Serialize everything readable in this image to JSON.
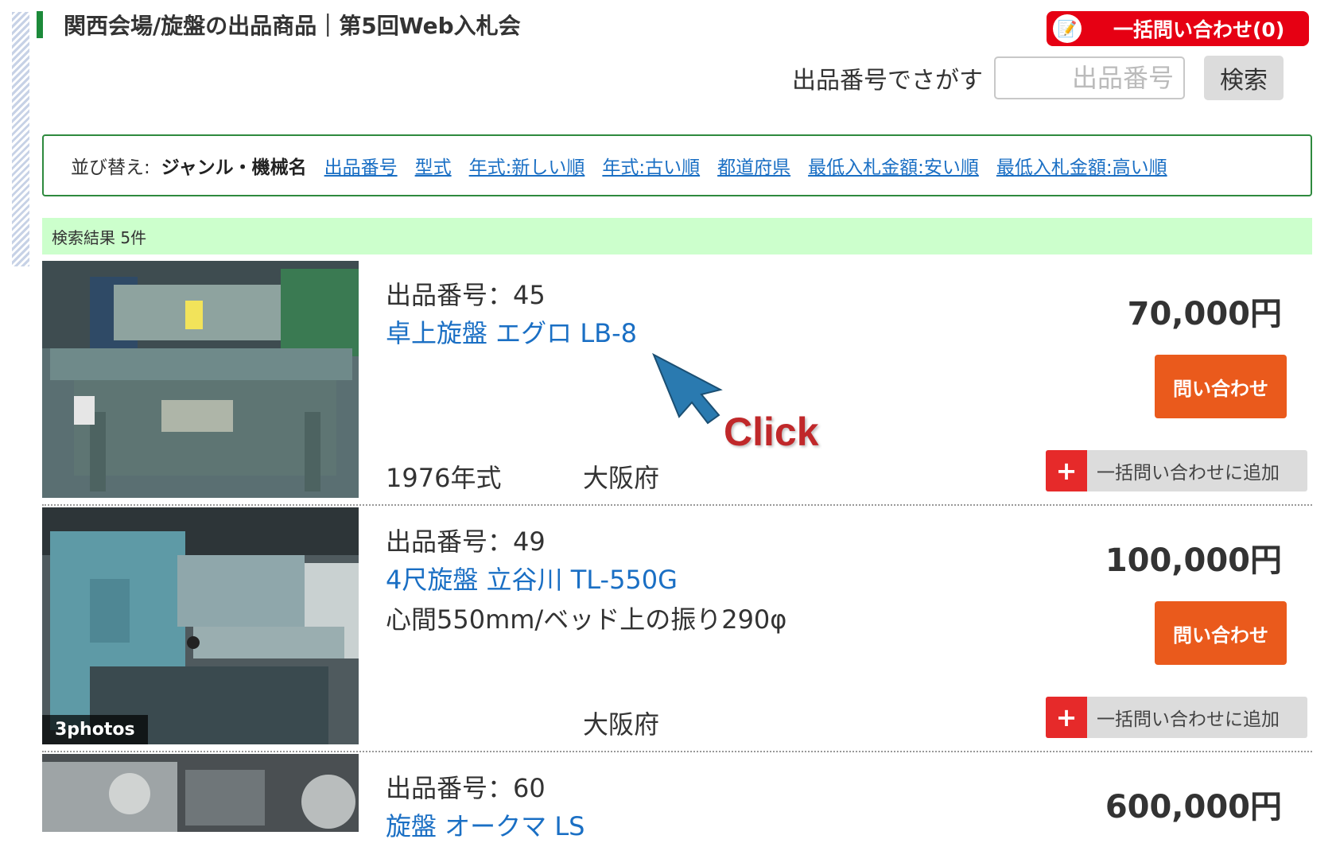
{
  "header": {
    "title": "関西会場/旋盤の出品商品｜第5回Web入札会",
    "bulk_inquiry_label": "一括問い合わせ(0)",
    "bulk_icon": "clipboard-icon"
  },
  "search": {
    "label": "出品番号でさがす",
    "placeholder": "出品番号",
    "value": "",
    "button_label": "検索"
  },
  "sort": {
    "label": "並び替え:",
    "current": "ジャンル・機械名",
    "options": [
      "出品番号",
      "型式",
      "年式:新しい順",
      "年式:古い順",
      "都道府県",
      "最低入札金額:安い順",
      "最低入札金額:高い順"
    ]
  },
  "results": {
    "summary": "検索結果 5件"
  },
  "items": [
    {
      "number": "出品番号：45",
      "name": "卓上旋盤 エグロ LB-8",
      "spec": "",
      "year": "1976年式",
      "prefecture": "大阪府",
      "price": "70,000円",
      "inquire_label": "問い合わせ",
      "add_label": "一括問い合わせに追加",
      "photos": ""
    },
    {
      "number": "出品番号：49",
      "name": "4尺旋盤 立谷川 TL-550G",
      "spec": "心間550mm/ベッド上の振り290φ",
      "year": "",
      "prefecture": "大阪府",
      "price": "100,000円",
      "inquire_label": "問い合わせ",
      "add_label": "一括問い合わせに追加",
      "photos": "3photos"
    },
    {
      "number": "出品番号：60",
      "name": "旋盤 オークマ LS",
      "price": "600,000円"
    }
  ],
  "overlay": {
    "click_label": "Click",
    "cursor_color": "#2a7ab0"
  },
  "colors": {
    "accent_green": "#1c8a3a",
    "link_blue": "#1a6fc4",
    "inquire_orange": "#ea5a1c",
    "bulk_red": "#e60013",
    "result_bar": "#ccffcc"
  }
}
